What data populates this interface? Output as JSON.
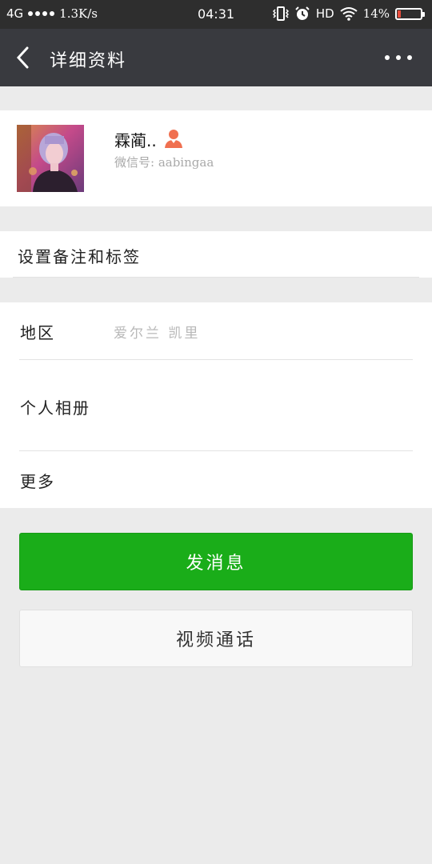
{
  "status_bar": {
    "network": "4G",
    "speed": "1.3K/s",
    "time": "04:31",
    "hd": "HD",
    "battery": "14%",
    "icons": [
      "signal-dots-icon",
      "vibrate-icon",
      "alarm-icon",
      "wifi-icon",
      "battery-icon"
    ]
  },
  "nav": {
    "title": "详细资料",
    "back_icon": "back-arrow-icon",
    "more_icon": "more-dots-icon"
  },
  "profile": {
    "name": "霖蔺..",
    "wechat_id": "微信号: aabingaa",
    "gender_icon": "female-user-icon",
    "gender_icon_color": "#f07050"
  },
  "remark": {
    "label": "设置备注和标签"
  },
  "info": {
    "region_label": "地区",
    "region_value": "爱尔兰  凯里",
    "album_label": "个人相册",
    "more_label": "更多"
  },
  "actions": {
    "send_message": "发消息",
    "video_call": "视频通话",
    "primary_color": "#1aad19"
  }
}
